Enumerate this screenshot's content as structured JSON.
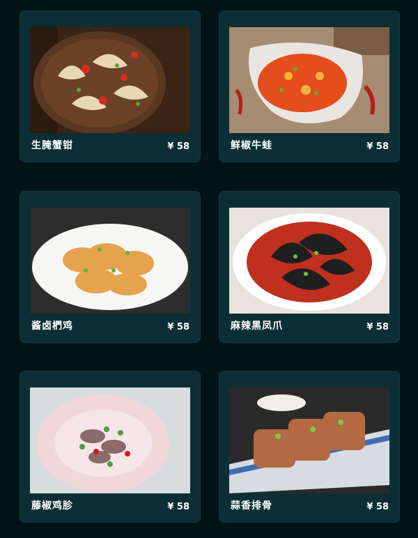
{
  "menu": {
    "items": [
      {
        "name": "生腌蟹钳",
        "price": "¥ 58"
      },
      {
        "name": "鲜椒牛蛙",
        "price": "¥ 58"
      },
      {
        "name": "酱卤椚鸡",
        "price": "¥ 58"
      },
      {
        "name": "麻辣黑凤爪",
        "price": "¥ 58"
      },
      {
        "name": "藤椒鸡胗",
        "price": "¥ 58"
      },
      {
        "name": "蒜香排骨",
        "price": "¥ 58"
      }
    ]
  },
  "colors": {
    "background": "#021417",
    "card": "#0c2f35",
    "text": "#ffffff"
  }
}
